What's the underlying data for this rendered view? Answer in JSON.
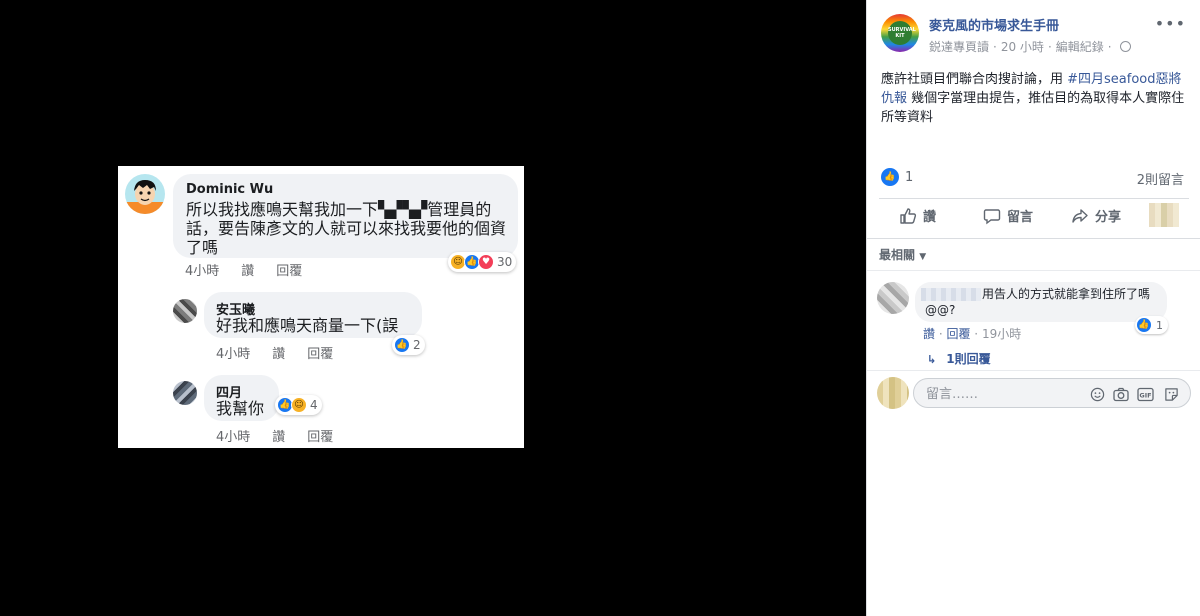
{
  "photo": {
    "comments": [
      {
        "name": "Dominic Wu",
        "text": "所以我找應鳴天幫我加一下▚▞▚▞管理員的話，要告陳彥文的人就可以來找我要他的個資了嗎",
        "meta_time": "4小時",
        "meta_like": "讚",
        "meta_reply": "回覆",
        "reaction_count": "30",
        "reactions": [
          "haha-icon",
          "like-icon",
          "love-icon"
        ]
      },
      {
        "name": "安玉曦",
        "text": "好我和應鳴天商量一下(誤",
        "meta_time": "4小時",
        "meta_like": "讚",
        "meta_reply": "回覆",
        "reaction_count": "2",
        "reactions": [
          "like-icon"
        ]
      },
      {
        "name": "四月",
        "text": "我幫你",
        "meta_time": "4小時",
        "meta_like": "讚",
        "meta_reply": "回覆",
        "reaction_count": "4",
        "reactions": [
          "like-icon",
          "haha-icon"
        ]
      }
    ]
  },
  "post": {
    "page_avatar_text": "SURVIVAL KIT",
    "page_name": "麥克風的市場求生手冊",
    "author": "鋭達專頁讀",
    "time": "20 小時",
    "edit_history": "編輯紀錄",
    "text_before": "應許社頭目們聯合肉搜討論，用 ",
    "hashtag": "#四月seafood惡將仇報",
    "text_after": " 幾個字當理由提告，推估目的為取得本人實際住所等資料",
    "like_count": "1",
    "comment_count": "2則留言",
    "actions": {
      "like": "讚",
      "comment": "留言",
      "share": "分享"
    },
    "sort_label": "最相關",
    "comment": {
      "text": "用告人的方式就能拿到住所了嗎@@?",
      "like": "讚",
      "reply": "回覆",
      "time": "19小時",
      "reaction_count": "1",
      "replies_link": "1則回覆"
    },
    "comment_box": {
      "placeholder": "留言……"
    }
  },
  "colors": {
    "link": "#385898",
    "like": "#1877f2",
    "background": "#000000"
  }
}
